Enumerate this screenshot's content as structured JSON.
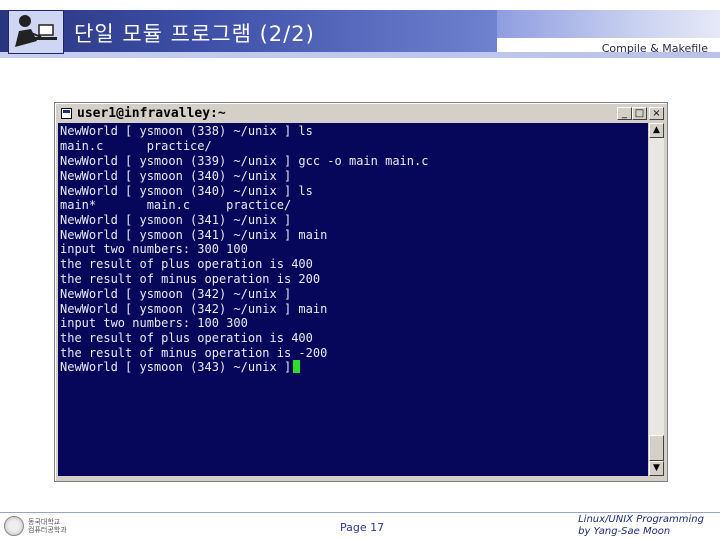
{
  "slide": {
    "title": "단일 모듈 프로그램 (2/2)",
    "subtitle": "Compile & Makefile"
  },
  "window": {
    "title": "user1@infravalley:~",
    "controls": {
      "minimize": "_",
      "maximize": "□",
      "close": "×"
    }
  },
  "terminal": {
    "lines": [
      "NewWorld [ ysmoon (338) ~/unix ] ls",
      "main.c      practice/",
      "NewWorld [ ysmoon (339) ~/unix ] gcc -o main main.c",
      "NewWorld [ ysmoon (340) ~/unix ]",
      "NewWorld [ ysmoon (340) ~/unix ] ls",
      "main*       main.c     practice/",
      "NewWorld [ ysmoon (341) ~/unix ]",
      "NewWorld [ ysmoon (341) ~/unix ] main",
      "input two numbers: 300 100",
      "the result of plus operation is 400",
      "the result of minus operation is 200",
      "NewWorld [ ysmoon (342) ~/unix ]",
      "NewWorld [ ysmoon (342) ~/unix ] main",
      "input two numbers: 100 300",
      "the result of plus operation is 400",
      "the result of minus operation is -200",
      "NewWorld [ ysmoon (343) ~/unix ]"
    ],
    "cursor_color": "#28e028",
    "background": "#06065a"
  },
  "footer": {
    "university": "동국대학교",
    "department": "컴퓨터공학과",
    "page": "Page 17",
    "credit_line1": "Linux/UNIX Programming",
    "credit_line2": "by Yang-Sae Moon"
  }
}
